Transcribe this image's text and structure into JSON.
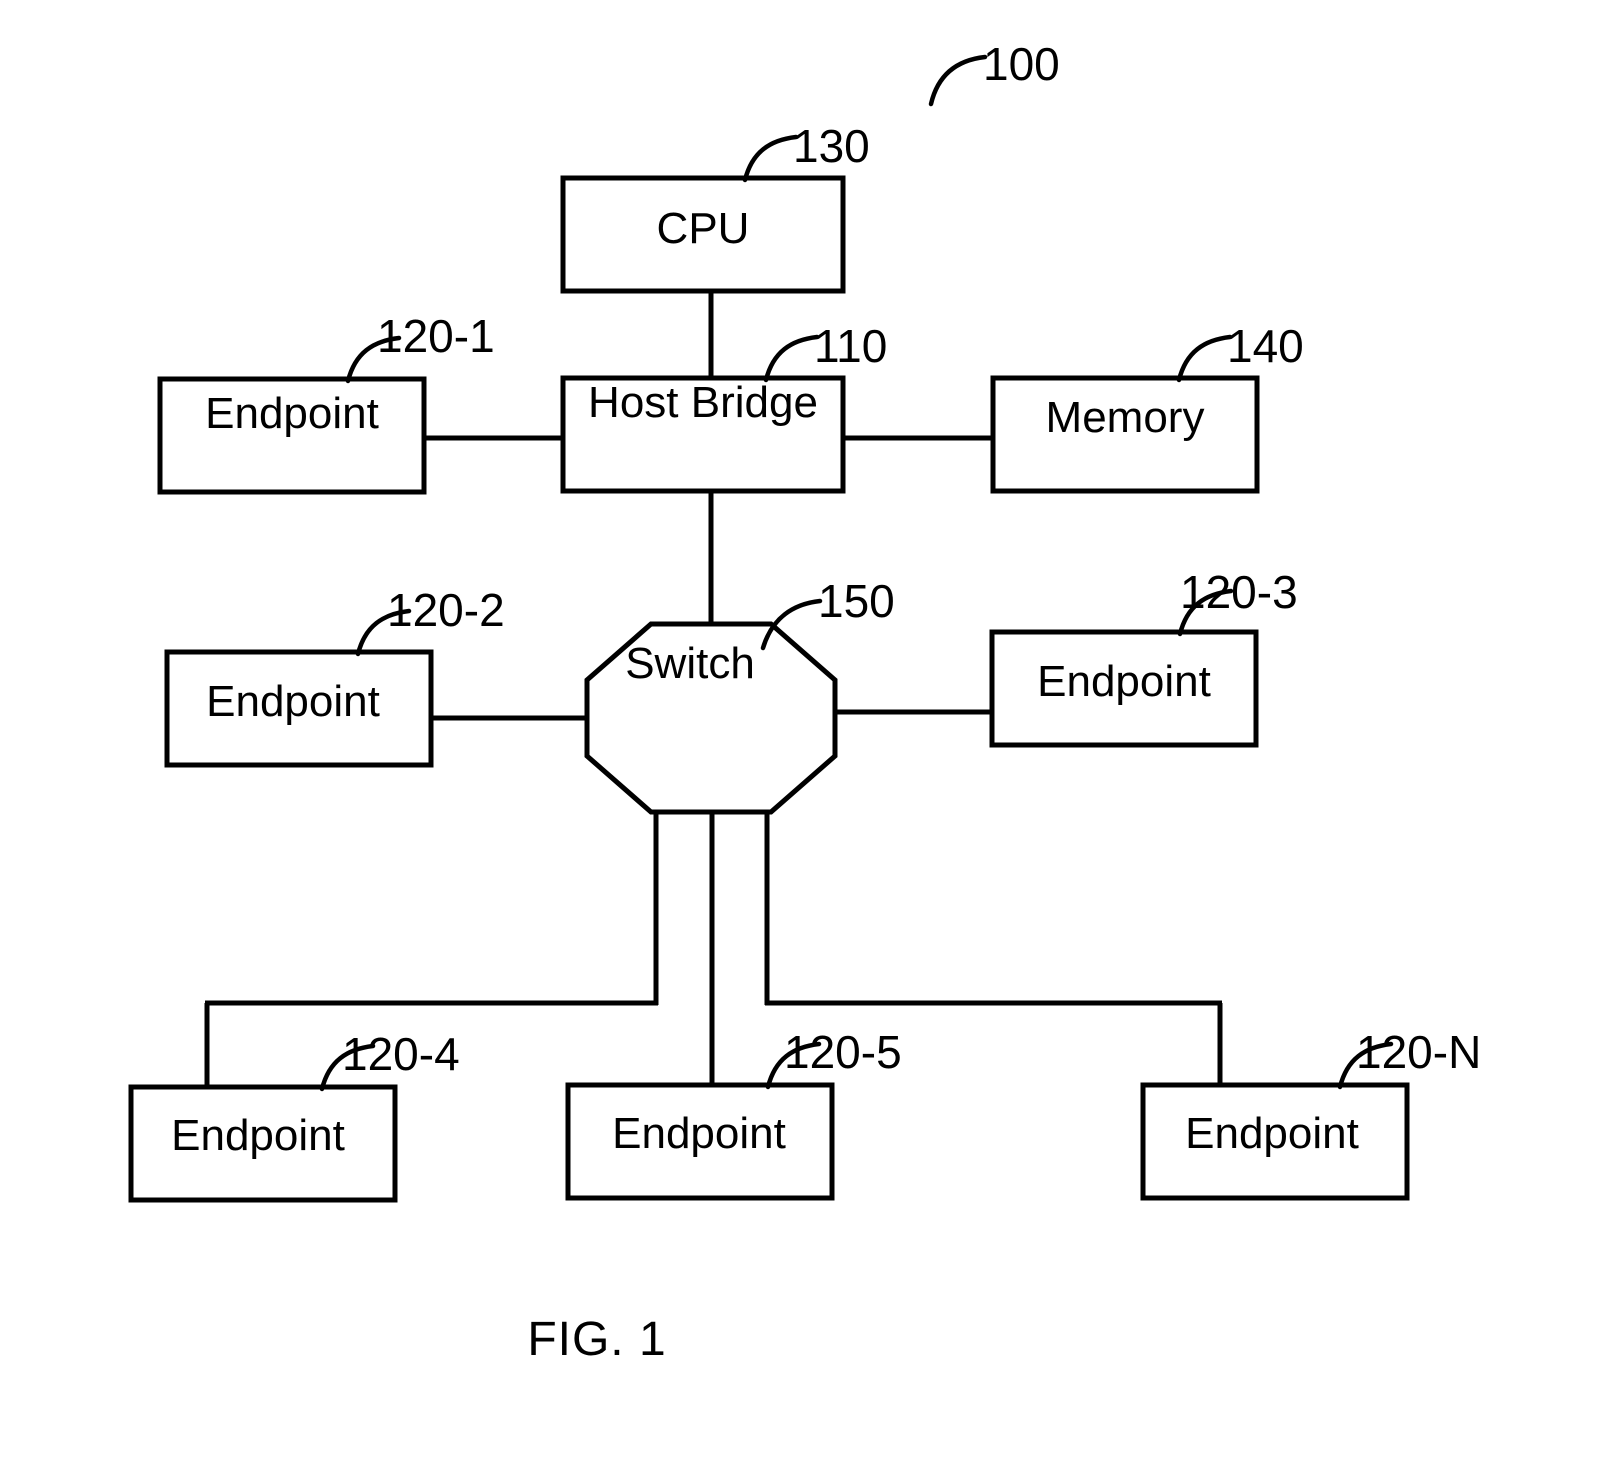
{
  "figure": {
    "caption": "FIG. 1",
    "system_reference": "100"
  },
  "nodes": {
    "cpu": {
      "label": "CPU",
      "reference": "130"
    },
    "host_bridge": {
      "label": "Host Bridge",
      "reference": "110"
    },
    "memory": {
      "label": "Memory",
      "reference": "140"
    },
    "switch": {
      "label": "Switch",
      "reference": "150"
    },
    "endpoint_1": {
      "label": "Endpoint",
      "reference": "120-1"
    },
    "endpoint_2": {
      "label": "Endpoint",
      "reference": "120-2"
    },
    "endpoint_3": {
      "label": "Endpoint",
      "reference": "120-3"
    },
    "endpoint_4": {
      "label": "Endpoint",
      "reference": "120-4"
    },
    "endpoint_5": {
      "label": "Endpoint",
      "reference": "120-5"
    },
    "endpoint_n": {
      "label": "Endpoint",
      "reference": "120-N"
    }
  },
  "connections": [
    {
      "from": "cpu",
      "to": "host_bridge"
    },
    {
      "from": "endpoint_1",
      "to": "host_bridge"
    },
    {
      "from": "host_bridge",
      "to": "memory"
    },
    {
      "from": "host_bridge",
      "to": "switch"
    },
    {
      "from": "endpoint_2",
      "to": "switch"
    },
    {
      "from": "switch",
      "to": "endpoint_3"
    },
    {
      "from": "switch",
      "to": "endpoint_4"
    },
    {
      "from": "switch",
      "to": "endpoint_5"
    },
    {
      "from": "switch",
      "to": "endpoint_n"
    }
  ],
  "style": {
    "background": "#ffffff",
    "stroke": "#000000"
  }
}
